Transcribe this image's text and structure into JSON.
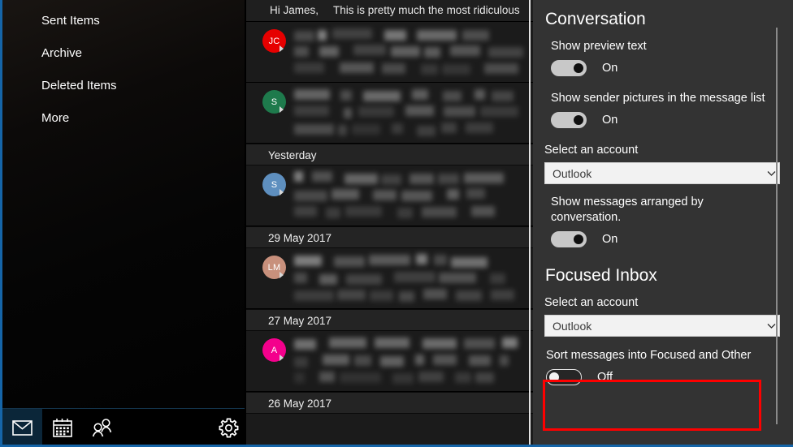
{
  "theme": {
    "accent": "#1565a8",
    "panel_bg": "#333333",
    "list_bg": "#1b1b1b",
    "sidebar_bg": "#050505",
    "highlight_box": "#fe0000",
    "active_tab_bg": "#0b2639"
  },
  "sidebar": {
    "folders": [
      {
        "label": "Sent Items",
        "name": "sidebar-item-sent-items"
      },
      {
        "label": "Archive",
        "name": "sidebar-item-archive"
      },
      {
        "label": "Deleted Items",
        "name": "sidebar-item-deleted-items"
      },
      {
        "label": "More",
        "name": "sidebar-item-more"
      }
    ],
    "nav": [
      {
        "label": "Mail",
        "icon": "mail-icon",
        "active": true
      },
      {
        "label": "Calendar",
        "icon": "calendar-icon",
        "active": false
      },
      {
        "label": "People",
        "icon": "people-icon",
        "active": false
      },
      {
        "label": "Settings",
        "icon": "gear-icon",
        "active": false
      }
    ]
  },
  "message_list": {
    "preview_strip": {
      "greeting": "Hi James,",
      "snippet": "This is pretty much the most ridiculous"
    },
    "rows": [
      {
        "kind": "message",
        "avatar": "JC",
        "avatar_color": "#e60000",
        "avatar_text_color": "#ffffff"
      },
      {
        "kind": "message",
        "avatar": "S",
        "avatar_color": "#1e7a4c",
        "avatar_text_color": "#ffffff"
      },
      {
        "kind": "date",
        "label": "Yesterday"
      },
      {
        "kind": "message",
        "avatar": "S",
        "avatar_color": "#5e8fbf",
        "avatar_text_color": "#ffffff"
      },
      {
        "kind": "date",
        "label": "29 May 2017"
      },
      {
        "kind": "message",
        "avatar": "LM",
        "avatar_color": "#c8907c",
        "avatar_text_color": "#ffffff"
      },
      {
        "kind": "date",
        "label": "27 May 2017"
      },
      {
        "kind": "message",
        "avatar": "A",
        "avatar_color": "#f4008c",
        "avatar_text_color": "#ffffff"
      },
      {
        "kind": "date",
        "label": "26 May 2017"
      }
    ]
  },
  "settings": {
    "conversation": {
      "title": "Conversation",
      "show_preview_text": {
        "label": "Show preview text",
        "state": "On",
        "on": true
      },
      "show_sender_pictures": {
        "label": "Show sender pictures in the message list",
        "state": "On",
        "on": true
      },
      "account_label": "Select an account",
      "account_value": "Outlook",
      "arrange_by_conversation": {
        "label": "Show messages arranged by conversation.",
        "state": "On",
        "on": true
      }
    },
    "focused_inbox": {
      "title": "Focused Inbox",
      "account_label": "Select an account",
      "account_value": "Outlook",
      "sort_messages": {
        "label": "Sort messages into Focused and Other",
        "state": "Off",
        "on": false
      }
    }
  }
}
